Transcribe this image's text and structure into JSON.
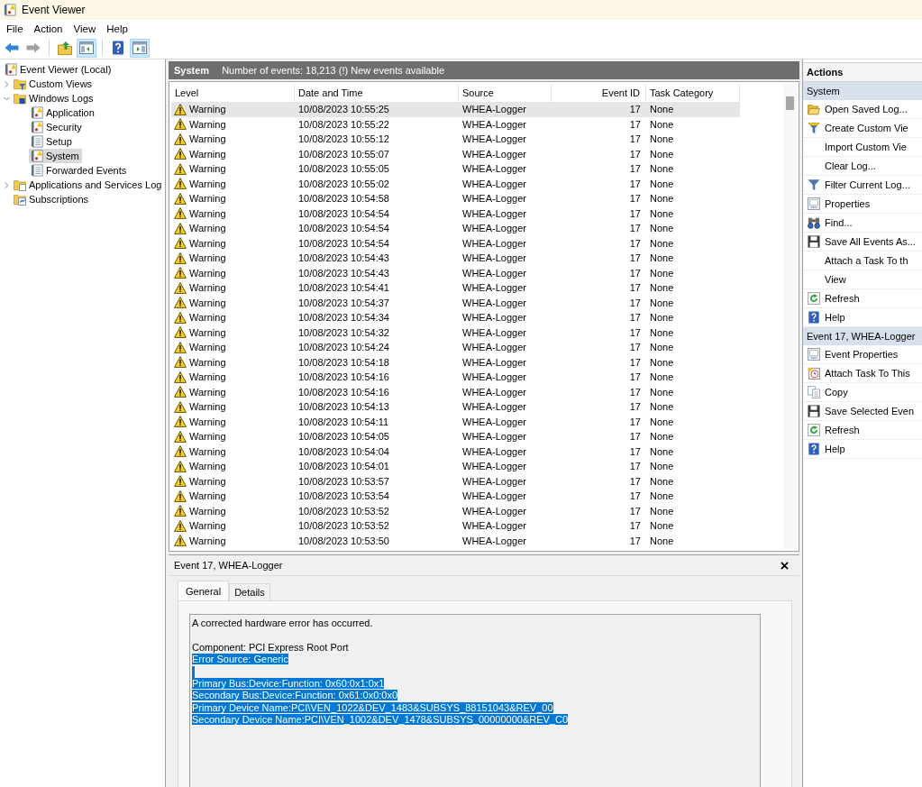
{
  "window": {
    "title": "Event Viewer"
  },
  "menu": [
    "File",
    "Action",
    "View",
    "Help"
  ],
  "toolbar": [
    [
      {
        "kind": "back",
        "on": false,
        "disabled": false
      },
      {
        "kind": "forward",
        "on": false,
        "disabled": true
      }
    ],
    [
      {
        "kind": "up",
        "on": false,
        "disabled": false
      },
      {
        "kind": "tree",
        "on": true,
        "disabled": false
      }
    ],
    [
      {
        "kind": "help",
        "on": false,
        "disabled": false
      },
      {
        "kind": "actions",
        "on": true,
        "disabled": false
      }
    ]
  ],
  "tree": [
    {
      "label": "Event Viewer (Local)",
      "kind": "root",
      "selected": false,
      "children": [
        {
          "label": "Custom Views",
          "kind": "filterfolder",
          "expanded": false,
          "selected": false
        },
        {
          "label": "Windows Logs",
          "kind": "logfolder",
          "expanded": true,
          "selected": false,
          "children": [
            {
              "label": "Application",
              "kind": "alertlog",
              "selected": false
            },
            {
              "label": "Security",
              "kind": "alertlog",
              "selected": false
            },
            {
              "label": "Setup",
              "kind": "log",
              "selected": false
            },
            {
              "label": "System",
              "kind": "alertlog",
              "selected": true
            },
            {
              "label": "Forwarded Events",
              "kind": "log",
              "selected": false
            }
          ]
        },
        {
          "label": "Applications and Services Log",
          "kind": "pagefolder",
          "expanded": false,
          "selected": false
        },
        {
          "label": "Subscriptions",
          "kind": "subscriptions",
          "selected": false
        }
      ]
    }
  ],
  "log": {
    "title": "System",
    "summary": "Number of events: 18,213 (!) New events available"
  },
  "table": {
    "columns": [
      "Level",
      "Date and Time",
      "Source",
      "Event ID",
      "Task Category"
    ],
    "rows": [
      {
        "level": "Warning",
        "date_time": "10/08/2023 10:55:25",
        "source": "WHEA-Logger",
        "event_id": "17",
        "task_category": "None",
        "selected": true
      },
      {
        "level": "Warning",
        "date_time": "10/08/2023 10:55:22",
        "source": "WHEA-Logger",
        "event_id": "17",
        "task_category": "None",
        "selected": false
      },
      {
        "level": "Warning",
        "date_time": "10/08/2023 10:55:12",
        "source": "WHEA-Logger",
        "event_id": "17",
        "task_category": "None",
        "selected": false
      },
      {
        "level": "Warning",
        "date_time": "10/08/2023 10:55:07",
        "source": "WHEA-Logger",
        "event_id": "17",
        "task_category": "None",
        "selected": false
      },
      {
        "level": "Warning",
        "date_time": "10/08/2023 10:55:05",
        "source": "WHEA-Logger",
        "event_id": "17",
        "task_category": "None",
        "selected": false
      },
      {
        "level": "Warning",
        "date_time": "10/08/2023 10:55:02",
        "source": "WHEA-Logger",
        "event_id": "17",
        "task_category": "None",
        "selected": false
      },
      {
        "level": "Warning",
        "date_time": "10/08/2023 10:54:58",
        "source": "WHEA-Logger",
        "event_id": "17",
        "task_category": "None",
        "selected": false
      },
      {
        "level": "Warning",
        "date_time": "10/08/2023 10:54:54",
        "source": "WHEA-Logger",
        "event_id": "17",
        "task_category": "None",
        "selected": false
      },
      {
        "level": "Warning",
        "date_time": "10/08/2023 10:54:54",
        "source": "WHEA-Logger",
        "event_id": "17",
        "task_category": "None",
        "selected": false
      },
      {
        "level": "Warning",
        "date_time": "10/08/2023 10:54:54",
        "source": "WHEA-Logger",
        "event_id": "17",
        "task_category": "None",
        "selected": false
      },
      {
        "level": "Warning",
        "date_time": "10/08/2023 10:54:43",
        "source": "WHEA-Logger",
        "event_id": "17",
        "task_category": "None",
        "selected": false
      },
      {
        "level": "Warning",
        "date_time": "10/08/2023 10:54:43",
        "source": "WHEA-Logger",
        "event_id": "17",
        "task_category": "None",
        "selected": false
      },
      {
        "level": "Warning",
        "date_time": "10/08/2023 10:54:41",
        "source": "WHEA-Logger",
        "event_id": "17",
        "task_category": "None",
        "selected": false
      },
      {
        "level": "Warning",
        "date_time": "10/08/2023 10:54:37",
        "source": "WHEA-Logger",
        "event_id": "17",
        "task_category": "None",
        "selected": false
      },
      {
        "level": "Warning",
        "date_time": "10/08/2023 10:54:34",
        "source": "WHEA-Logger",
        "event_id": "17",
        "task_category": "None",
        "selected": false
      },
      {
        "level": "Warning",
        "date_time": "10/08/2023 10:54:32",
        "source": "WHEA-Logger",
        "event_id": "17",
        "task_category": "None",
        "selected": false
      },
      {
        "level": "Warning",
        "date_time": "10/08/2023 10:54:24",
        "source": "WHEA-Logger",
        "event_id": "17",
        "task_category": "None",
        "selected": false
      },
      {
        "level": "Warning",
        "date_time": "10/08/2023 10:54:18",
        "source": "WHEA-Logger",
        "event_id": "17",
        "task_category": "None",
        "selected": false
      },
      {
        "level": "Warning",
        "date_time": "10/08/2023 10:54:16",
        "source": "WHEA-Logger",
        "event_id": "17",
        "task_category": "None",
        "selected": false
      },
      {
        "level": "Warning",
        "date_time": "10/08/2023 10:54:16",
        "source": "WHEA-Logger",
        "event_id": "17",
        "task_category": "None",
        "selected": false
      },
      {
        "level": "Warning",
        "date_time": "10/08/2023 10:54:13",
        "source": "WHEA-Logger",
        "event_id": "17",
        "task_category": "None",
        "selected": false
      },
      {
        "level": "Warning",
        "date_time": "10/08/2023 10:54:11",
        "source": "WHEA-Logger",
        "event_id": "17",
        "task_category": "None",
        "selected": false
      },
      {
        "level": "Warning",
        "date_time": "10/08/2023 10:54:05",
        "source": "WHEA-Logger",
        "event_id": "17",
        "task_category": "None",
        "selected": false
      },
      {
        "level": "Warning",
        "date_time": "10/08/2023 10:54:04",
        "source": "WHEA-Logger",
        "event_id": "17",
        "task_category": "None",
        "selected": false
      },
      {
        "level": "Warning",
        "date_time": "10/08/2023 10:54:01",
        "source": "WHEA-Logger",
        "event_id": "17",
        "task_category": "None",
        "selected": false
      },
      {
        "level": "Warning",
        "date_time": "10/08/2023 10:53:57",
        "source": "WHEA-Logger",
        "event_id": "17",
        "task_category": "None",
        "selected": false
      },
      {
        "level": "Warning",
        "date_time": "10/08/2023 10:53:54",
        "source": "WHEA-Logger",
        "event_id": "17",
        "task_category": "None",
        "selected": false
      },
      {
        "level": "Warning",
        "date_time": "10/08/2023 10:53:52",
        "source": "WHEA-Logger",
        "event_id": "17",
        "task_category": "None",
        "selected": false
      },
      {
        "level": "Warning",
        "date_time": "10/08/2023 10:53:52",
        "source": "WHEA-Logger",
        "event_id": "17",
        "task_category": "None",
        "selected": false
      },
      {
        "level": "Warning",
        "date_time": "10/08/2023 10:53:50",
        "source": "WHEA-Logger",
        "event_id": "17",
        "task_category": "None",
        "selected": false
      }
    ]
  },
  "detail": {
    "title": "Event 17, WHEA-Logger",
    "tabs": [
      {
        "label": "General",
        "selected": true
      },
      {
        "label": "Details",
        "selected": false
      }
    ],
    "description": [
      {
        "kind": "text",
        "text": "A corrected hardware error has occurred.",
        "selected": false
      },
      {
        "kind": "blank",
        "selected": false
      },
      {
        "kind": "text",
        "text": "Component: PCI Express Root Port",
        "selected": false
      },
      {
        "kind": "text",
        "text": "Error Source: Generic",
        "selected": true
      },
      {
        "kind": "blank",
        "selected": true
      },
      {
        "kind": "text",
        "text": "Primary Bus:Device:Function: 0x60:0x1:0x1",
        "selected": true
      },
      {
        "kind": "text",
        "text": "Secondary Bus:Device:Function: 0x61:0x0:0x0",
        "selected": true
      },
      {
        "kind": "text",
        "text": "Primary Device Name:PCI\\VEN_1022&DEV_1483&SUBSYS_88151043&REV_00",
        "selected": true
      },
      {
        "kind": "text",
        "text": "Secondary Device Name:PCI\\VEN_1002&DEV_1478&SUBSYS_00000000&REV_C0",
        "selected": true
      }
    ]
  },
  "actions": {
    "title": "Actions",
    "sections": [
      {
        "title": "System",
        "items": [
          {
            "label": "Open Saved Log...",
            "kind": "open"
          },
          {
            "label": "Create Custom Vie",
            "kind": "customview"
          },
          {
            "label": "Import Custom Vie",
            "kind": "plain"
          },
          {
            "label": "Clear Log...",
            "kind": "plain"
          },
          {
            "label": "Filter Current Log...",
            "kind": "filter"
          },
          {
            "label": "Properties",
            "kind": "properties"
          },
          {
            "label": "Find...",
            "kind": "find"
          },
          {
            "label": "Save All Events As...",
            "kind": "save"
          },
          {
            "label": "Attach a Task To th",
            "kind": "plain"
          },
          {
            "label": "View",
            "kind": "plain"
          },
          {
            "label": "Refresh",
            "kind": "refresh"
          },
          {
            "label": "Help",
            "kind": "help"
          }
        ]
      },
      {
        "title": "Event 17, WHEA-Logger",
        "items": [
          {
            "label": "Event Properties",
            "kind": "properties"
          },
          {
            "label": "Attach Task To This",
            "kind": "task"
          },
          {
            "label": "Copy",
            "kind": "copy"
          },
          {
            "label": "Save Selected Even",
            "kind": "save"
          },
          {
            "label": "Refresh",
            "kind": "refresh"
          },
          {
            "label": "Help",
            "kind": "help"
          }
        ]
      }
    ]
  }
}
